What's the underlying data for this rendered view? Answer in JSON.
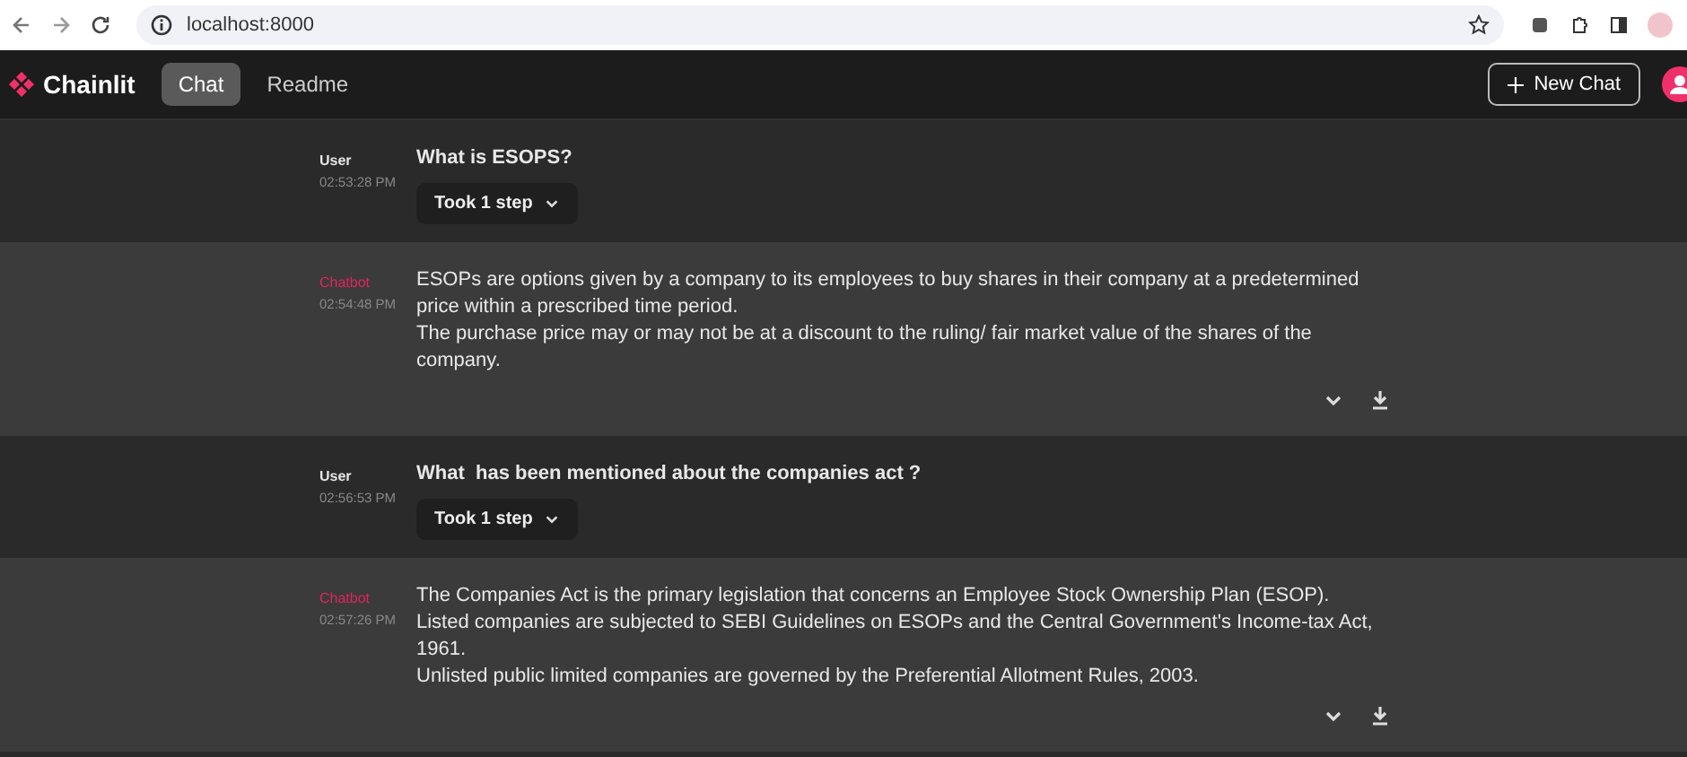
{
  "browser": {
    "url": "localhost:8000"
  },
  "header": {
    "app_name": "Chainlit",
    "tabs": [
      {
        "label": "Chat",
        "selected": true
      },
      {
        "label": "Readme",
        "selected": false
      }
    ],
    "new_chat": "New Chat"
  },
  "messages": [
    {
      "kind": "user",
      "author": "User",
      "time": "02:53:28 PM",
      "paragraphs": [
        "What is ESOPS?"
      ],
      "steps": "Took 1 step"
    },
    {
      "kind": "bot",
      "author": "Chatbot",
      "time": "02:54:48 PM",
      "paragraphs": [
        "ESOPs are options given by a company to its employees to buy shares in their company at a predetermined price within a prescribed time period.",
        "The purchase price may or may not be at a discount to the ruling/ fair market value of the shares of the company."
      ]
    },
    {
      "kind": "user",
      "author": "User",
      "time": "02:56:53 PM",
      "paragraphs": [
        "What  has been mentioned about the companies act ?"
      ],
      "steps": "Took 1 step"
    },
    {
      "kind": "bot",
      "author": "Chatbot",
      "time": "02:57:26 PM",
      "paragraphs": [
        "The Companies Act is the primary legislation that concerns an Employee Stock Ownership Plan (ESOP).",
        "Listed companies are subjected to SEBI Guidelines on ESOPs and the Central Government's Income-tax Act, 1961.",
        "Unlisted public limited companies are governed by the Preferential Allotment Rules, 2003."
      ]
    }
  ]
}
